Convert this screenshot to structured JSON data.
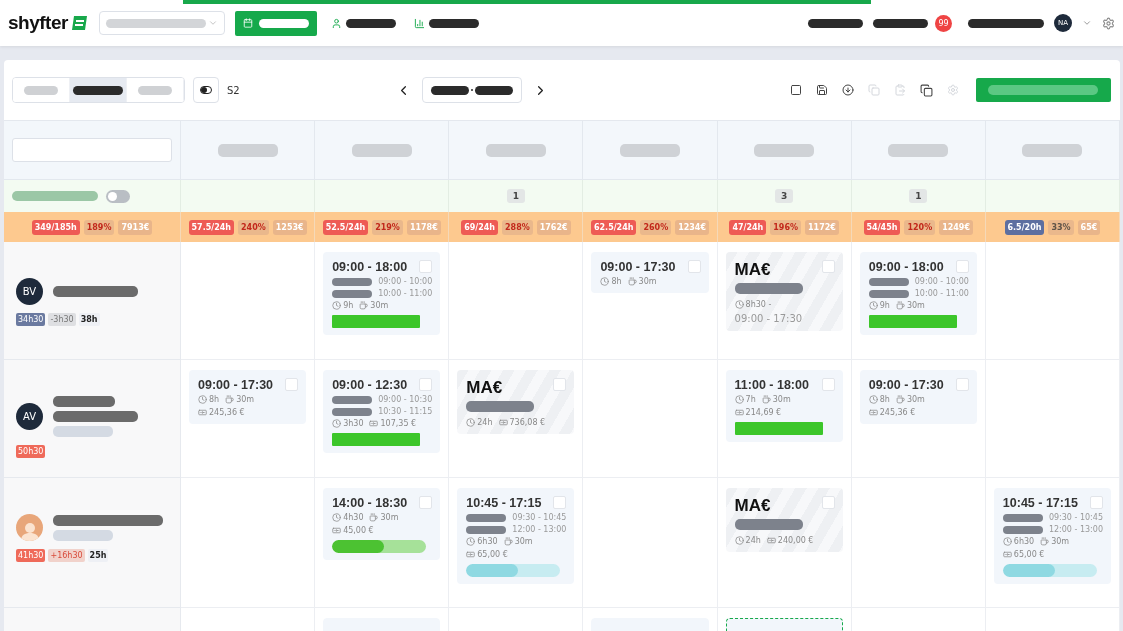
{
  "nav": {
    "logo": "shyfter",
    "notification_count": "99",
    "user_initials": "NA"
  },
  "toolbar": {
    "view_tabs": [
      {
        "selected": false
      },
      {
        "selected": true
      },
      {
        "selected": false
      }
    ],
    "week_label": "S2"
  },
  "grid": {
    "filter_toggle": {
      "on": false
    },
    "counts": [
      {
        "kind": "empty"
      },
      {
        "kind": "empty"
      },
      {
        "kind": "count",
        "count": "1"
      },
      {
        "kind": "empty"
      },
      {
        "kind": "count",
        "count": "3"
      },
      {
        "kind": "count",
        "count": "1"
      },
      {
        "kind": "empty"
      }
    ],
    "total_stats": {
      "kind": "over",
      "hours": "349/185h",
      "percent": "189%",
      "cost": "7913€"
    },
    "day_stats": [
      {
        "kind": "over",
        "hours": "57.5/24h",
        "percent": "240%",
        "cost": "1253€"
      },
      {
        "kind": "over",
        "hours": "52.5/24h",
        "percent": "219%",
        "cost": "1178€"
      },
      {
        "kind": "over",
        "hours": "69/24h",
        "percent": "288%",
        "cost": "1762€"
      },
      {
        "kind": "over",
        "hours": "62.5/24h",
        "percent": "260%",
        "cost": "1234€"
      },
      {
        "kind": "over",
        "hours": "47/24h",
        "percent": "196%",
        "cost": "1172€"
      },
      {
        "kind": "over",
        "hours": "54/45h",
        "percent": "120%",
        "cost": "1249€"
      },
      {
        "kind": "under",
        "hours": "6.5/20h",
        "percent": "33%",
        "cost": "65€"
      }
    ],
    "employees": [
      {
        "avatar": {
          "kind": "initials",
          "initials": "BV"
        },
        "name_bars": [
          {
            "kind": "dark"
          }
        ],
        "tags": [
          {
            "kind": "planned",
            "text": "34h30"
          },
          {
            "kind": "diff",
            "text": "-3h30"
          },
          {
            "kind": "contract",
            "text": "38h"
          }
        ],
        "cells": [
          null,
          {
            "kind": "shift",
            "checked": false,
            "time": "09:00 - 18:00",
            "tasks": [
              {
                "time": "09:00 - 10:00"
              },
              {
                "time": "10:00 - 11:00"
              }
            ],
            "duration": "9h",
            "break": "30m",
            "bar": {
              "color": "#3cc62a",
              "level": 1
            }
          },
          null,
          {
            "kind": "shift",
            "checked": false,
            "time": "09:00 - 17:30",
            "duration": "8h",
            "break": "30m"
          },
          {
            "kind": "absence",
            "checked": false,
            "title": "MA€",
            "duration": "8h30 -",
            "range": "09:00 - 17:30"
          },
          {
            "kind": "shift",
            "checked": false,
            "time": "09:00 - 18:00",
            "tasks": [
              {
                "time": "09:00 - 10:00"
              },
              {
                "time": "10:00 - 11:00"
              }
            ],
            "duration": "9h",
            "break": "30m",
            "bar": {
              "color": "#3cc62a",
              "level": 1
            }
          },
          null
        ]
      },
      {
        "avatar": {
          "kind": "initials",
          "initials": "AV"
        },
        "name_bars": [
          {
            "kind": "dark"
          },
          {
            "kind": "dark"
          },
          {
            "kind": "light"
          }
        ],
        "tags": [
          {
            "kind": "over",
            "text": "50h30"
          }
        ],
        "cells": [
          {
            "kind": "shift",
            "checked": false,
            "time": "09:00 - 17:30",
            "duration": "8h",
            "break": "30m",
            "cost": "245,36 €"
          },
          {
            "kind": "shift",
            "checked": false,
            "time": "09:00 - 12:30",
            "tasks": [
              {
                "time": "09:00 - 10:30"
              },
              {
                "time": "10:30 - 11:15"
              }
            ],
            "duration": "3h30",
            "cost": "107,35 €",
            "bar": {
              "color": "#3cc62a",
              "level": 1
            }
          },
          {
            "kind": "absence",
            "checked": false,
            "title": "MA€",
            "duration": "24h",
            "cost": "736,08 €"
          },
          null,
          {
            "kind": "shift",
            "checked": false,
            "time": "11:00 - 18:00",
            "duration": "7h",
            "break": "30m",
            "cost": "214,69 €",
            "bar": {
              "color": "#3cc62a",
              "level": 1
            }
          },
          {
            "kind": "shift",
            "checked": false,
            "time": "09:00 - 17:30",
            "duration": "8h",
            "break": "30m",
            "cost": "245,36 €"
          },
          null
        ]
      },
      {
        "avatar": {
          "kind": "photo"
        },
        "name_bars": [
          {
            "kind": "dark"
          },
          {
            "kind": "light"
          }
        ],
        "tags": [
          {
            "kind": "over",
            "text": "41h30"
          },
          {
            "kind": "diff-over",
            "text": "+16h30"
          },
          {
            "kind": "contract",
            "text": "25h"
          }
        ],
        "cells": [
          null,
          {
            "kind": "shift",
            "checked": false,
            "time": "14:00 - 18:30",
            "duration": "4h30",
            "break": "30m",
            "cost": "45,00 €",
            "bar": {
              "color": "#4cc232",
              "level": 0.55
            }
          },
          {
            "kind": "shift",
            "checked": false,
            "time": "10:45 - 17:15",
            "tasks": [
              {
                "time": "09:30 - 10:45"
              },
              {
                "time": "12:00 - 13:00"
              }
            ],
            "duration": "6h30",
            "break": "30m",
            "cost": "65,00 €",
            "bar": {
              "color": "#8fd9e2",
              "level": 0.55
            }
          },
          null,
          {
            "kind": "absence",
            "checked": false,
            "title": "MA€",
            "duration": "24h",
            "cost": "240,00 €"
          },
          null,
          {
            "kind": "shift",
            "checked": false,
            "time": "10:45 - 17:15",
            "tasks": [
              {
                "time": "09:30 - 10:45"
              },
              {
                "time": "12:00 - 13:00"
              }
            ],
            "duration": "6h30",
            "break": "30m",
            "cost": "65,00 €",
            "bar": {
              "color": "#8fd9e2",
              "level": 0.55
            }
          }
        ]
      },
      {
        "avatar": {
          "kind": "none"
        },
        "cells": [
          null,
          {
            "kind": "cut",
            "dashed": false
          },
          null,
          {
            "kind": "cut",
            "dashed": false
          },
          {
            "kind": "cut",
            "dashed": true
          },
          null,
          null
        ]
      }
    ]
  }
}
